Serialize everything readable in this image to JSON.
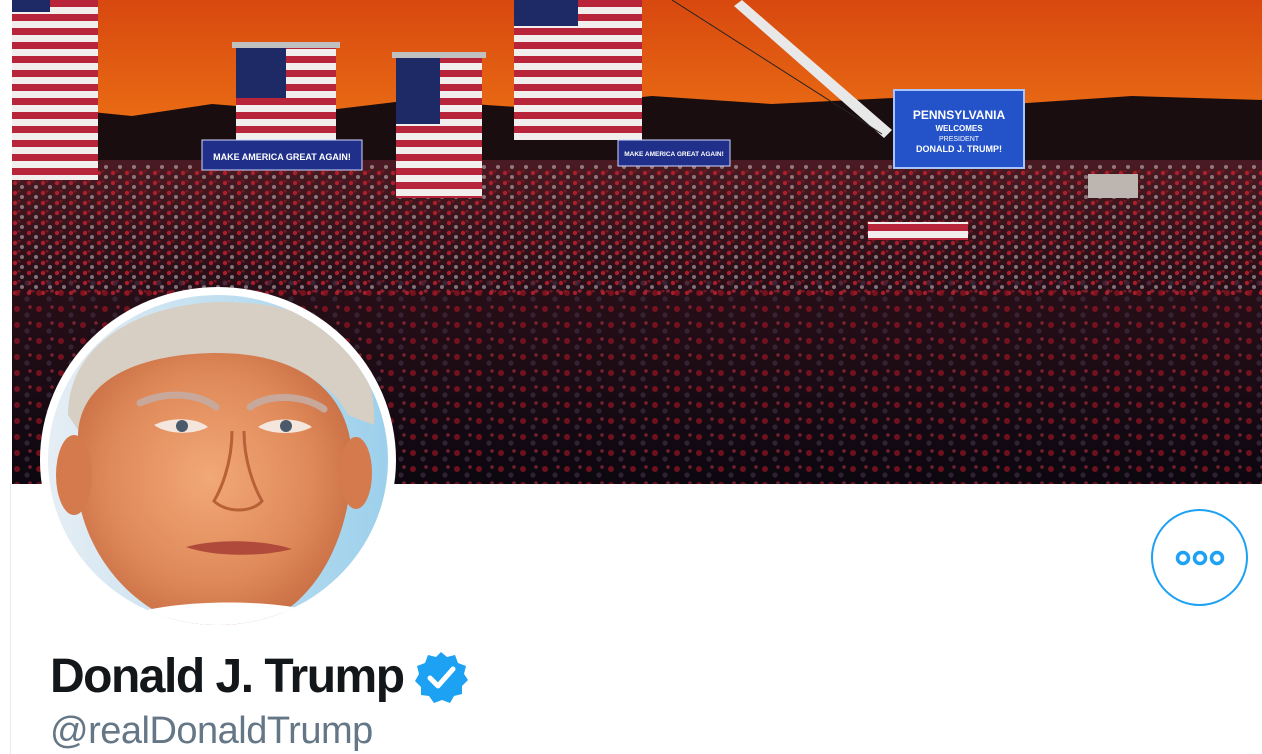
{
  "profile": {
    "display_name": "Donald J. Trump",
    "handle": "@realDonaldTrump",
    "verified": true
  },
  "banner": {
    "signs": {
      "left_banner": "MAKE AMERICA GREAT AGAIN!",
      "center_banner": "MAKE AMERICA GREAT AGAIN!",
      "screen_line1": "PENNSYLVANIA",
      "screen_line2": "WELCOMES",
      "screen_line3": "PRESIDENT",
      "screen_line4": "DONALD J. TRUMP!"
    }
  },
  "icons": {
    "more": "more-horizontal-icon",
    "verified": "verified-badge-icon"
  },
  "colors": {
    "accent": "#1da1f2",
    "name_text": "#14171a",
    "handle_text": "#657786"
  }
}
